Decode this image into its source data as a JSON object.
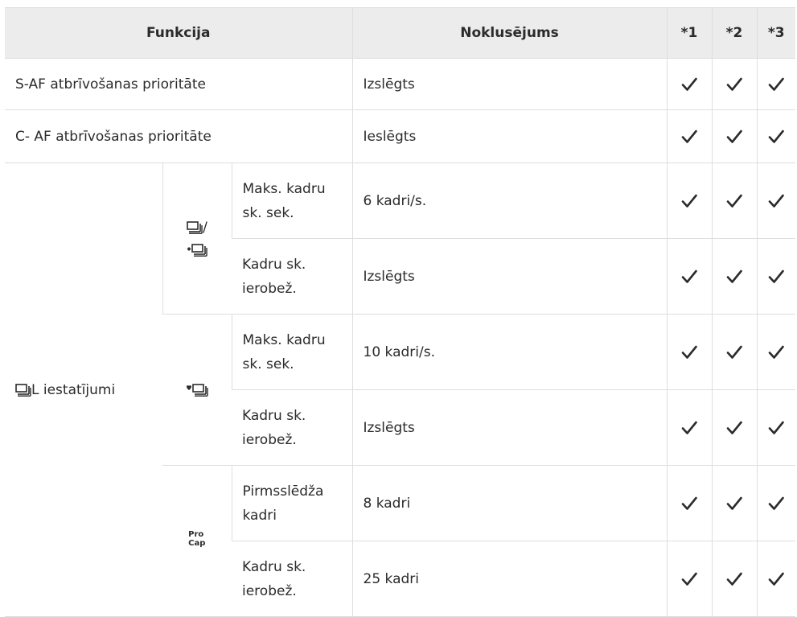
{
  "header": {
    "function": "Funkcija",
    "default": "Noklusējums",
    "col1": "*1",
    "col2": "*2",
    "col3": "*3"
  },
  "rows": {
    "s_af": {
      "label": "S-AF atbrīvošanas prioritāte",
      "value": "Izslēgts"
    },
    "c_af": {
      "label": "C- AF atbrīvošanas prioritāte",
      "value": "Ieslēgts"
    },
    "group": {
      "label": "L iestatījumi",
      "label_icon": "sequential-low-icon",
      "sub1": {
        "icon_top": "sequential-icon",
        "slash": "/",
        "icon_bottom": "silent-sequential-icon",
        "r1": {
          "setting": "Maks. kadru sk. sek.",
          "value": "6 kadri/s."
        },
        "r2": {
          "setting": "Kadru sk. ierobež.",
          "value": "Izslēgts"
        }
      },
      "sub2": {
        "icon": "silent-heart-sequential-icon",
        "r1": {
          "setting": "Maks. kadru sk. sek.",
          "value": "10 kadri/s."
        },
        "r2": {
          "setting": "Kadru sk. ierobež.",
          "value": "Izslēgts"
        }
      },
      "sub3": {
        "icon_line1": "Pro",
        "icon_line2": "Cap",
        "r1": {
          "setting": "Pirmsslēdža kadri",
          "value": "8 kadri"
        },
        "r2": {
          "setting": "Kadru sk. ierobež.",
          "value": "25 kadri"
        }
      }
    }
  },
  "check_icon": "checkmark-icon",
  "colors": {
    "header_bg": "#ececec",
    "border": "#dedede",
    "text": "#2b2b2b"
  }
}
